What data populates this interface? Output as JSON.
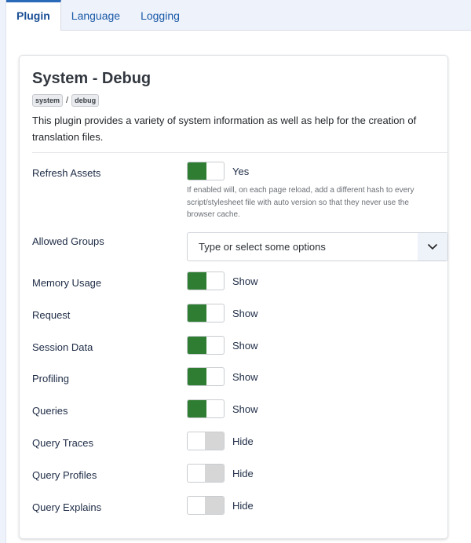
{
  "tabs": [
    {
      "label": "Plugin",
      "active": true
    },
    {
      "label": "Language",
      "active": false
    },
    {
      "label": "Logging",
      "active": false
    }
  ],
  "card": {
    "title": "System - Debug",
    "tags": [
      "system",
      "debug"
    ],
    "tag_separator": "/",
    "description": "This plugin provides a variety of system information as well as help for the creation of translation files."
  },
  "fields": {
    "refresh_assets": {
      "label": "Refresh Assets",
      "state": "on",
      "value_text": "Yes",
      "help": "If enabled will, on each page reload, add a different hash to every script/stylesheet file with auto version so that they never use the browser cache."
    },
    "allowed_groups": {
      "label": "Allowed Groups",
      "placeholder": "Type or select some options",
      "caret_icon": "chevron-down-icon"
    },
    "toggles": [
      {
        "label": "Memory Usage",
        "state": "on",
        "value_text": "Show"
      },
      {
        "label": "Request",
        "state": "on",
        "value_text": "Show"
      },
      {
        "label": "Session Data",
        "state": "on",
        "value_text": "Show"
      },
      {
        "label": "Profiling",
        "state": "on",
        "value_text": "Show"
      },
      {
        "label": "Queries",
        "state": "on",
        "value_text": "Show"
      },
      {
        "label": "Query Traces",
        "state": "off",
        "value_text": "Hide"
      },
      {
        "label": "Query Profiles",
        "state": "off",
        "value_text": "Hide"
      },
      {
        "label": "Query Explains",
        "state": "off",
        "value_text": "Hide"
      }
    ]
  },
  "colors": {
    "switch_on": "#2e7d32",
    "switch_off": "#d6d6d6",
    "tab_accent": "#2a69b8"
  }
}
